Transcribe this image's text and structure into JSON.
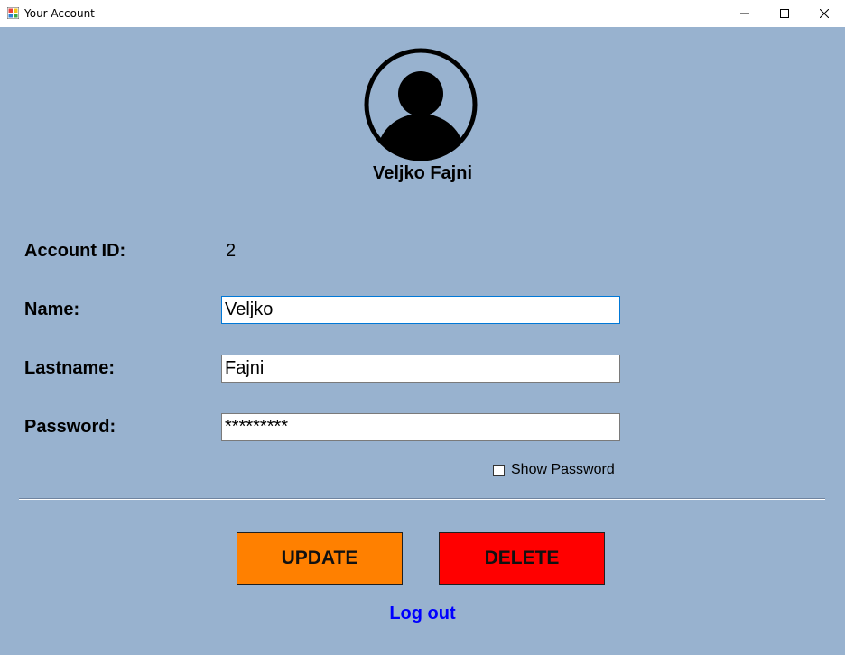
{
  "window": {
    "title": "Your Account"
  },
  "profile": {
    "display_name": "Veljko Fajni"
  },
  "form": {
    "account_id_label": "Account ID:",
    "account_id_value": "2",
    "name_label": "Name:",
    "name_value": "Veljko",
    "lastname_label": "Lastname:",
    "lastname_value": "Fajni",
    "password_label": "Password:",
    "password_value": "*********",
    "show_password_label": "Show Password",
    "show_password_checked": false
  },
  "actions": {
    "update_label": "UPDATE",
    "delete_label": "DELETE",
    "logout_label": "Log out"
  },
  "colors": {
    "background": "#98b2cf",
    "update_button": "#ff8000",
    "delete_button": "#ff0000",
    "logout_link": "#0000ff"
  },
  "icons": {
    "app": "app-icon",
    "avatar": "user-avatar-icon",
    "minimize": "minimize-icon",
    "maximize": "maximize-icon",
    "close": "close-icon"
  }
}
